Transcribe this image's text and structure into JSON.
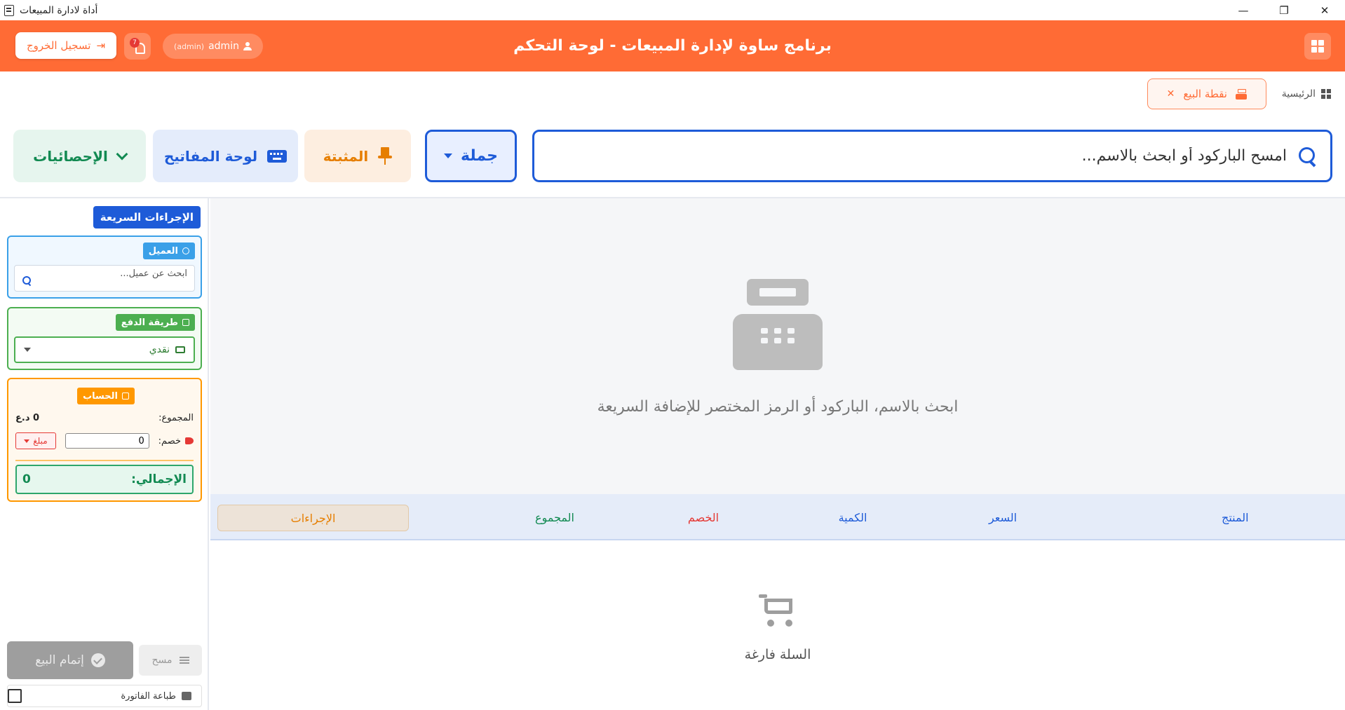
{
  "window": {
    "title": "أداة لادارة المبيعات",
    "minimize": "—",
    "restore": "❐",
    "close": "✕"
  },
  "header": {
    "title": "برنامج ساوة لإدارة المبيعات - لوحة التحكم",
    "logout_label": "تسجيل الخروج",
    "notifications_count": "7",
    "user_name": "admin",
    "user_role": "(admin)",
    "accent_color": "#ff6b35"
  },
  "breadcrumb": {
    "home_label": "الرئيسية",
    "active_tab": "نقطة البيع",
    "close_tab": "✕"
  },
  "toolbar": {
    "search_placeholder": "امسح الباركود أو ابحث بالاسم...",
    "mode_label": "جملة",
    "pinned_label": "المثبتة",
    "keyboard_label": "لوحة المفاتيح",
    "stats_label": "الإحصائيات"
  },
  "sidebar": {
    "quick_actions_label": "الإجراءات السريعة",
    "customer": {
      "label": "العميل",
      "placeholder": "ابحث عن عميل..."
    },
    "payment": {
      "label": "طريقة الدفع",
      "selected": "نقدي"
    },
    "account": {
      "label": "الحساب",
      "subtotal_label": "المجموع:",
      "subtotal_value": "0 د.ع",
      "discount_label": "خصم:",
      "discount_value": "0",
      "discount_type": "مبلغ",
      "grand_total_label": "الإجمالي:",
      "grand_total_value": "0"
    },
    "complete_sale_label": "إتمام البيع",
    "clear_label": "مسح",
    "print_invoice_label": "طباعة الفاتورة"
  },
  "main": {
    "hint_text": "ابحث بالاسم، الباركود أو الرمز المختصر للإضافة السريعة",
    "columns": {
      "product": "المنتج",
      "price": "السعر",
      "quantity": "الكمية",
      "discount": "الخصم",
      "total": "المجموع",
      "actions": "الإجراءات"
    },
    "empty_cart_text": "السلة فارغة"
  }
}
